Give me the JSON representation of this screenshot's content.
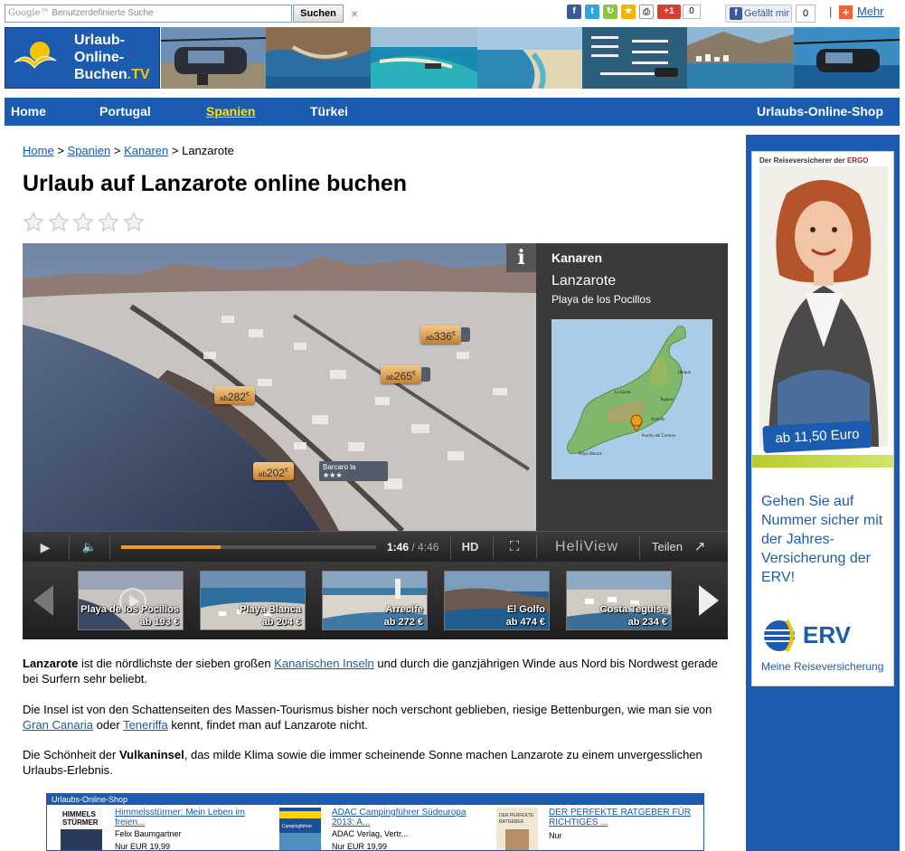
{
  "topbar": {
    "search_placeholder": "Benutzerdefinierte Suche",
    "search_brand": "Google™",
    "search_button": "Suchen",
    "clear": "×",
    "gplus_label": "+1",
    "gplus_count": "0",
    "share_count": "0",
    "fb_like_label": "Gefällt mir",
    "fb_like_count": "0",
    "more_plus": "+",
    "more_label": "Mehr"
  },
  "logo": {
    "line1": "Urlaub-",
    "line2": "Online-",
    "line3": "Buchen",
    "line3_suffix": ".TV"
  },
  "nav": {
    "items": [
      {
        "label": "Home"
      },
      {
        "label": "Portugal"
      },
      {
        "label": "Spanien"
      },
      {
        "label": "Türkei"
      }
    ],
    "shop": "Urlaubs-Online-Shop"
  },
  "breadcrumb": {
    "home": "Home",
    "sep": ">",
    "spanien": "Spanien",
    "kanaren": "Kanaren",
    "current": "Lanzarote"
  },
  "page_title": "Urlaub auf Lanzarote online buchen",
  "rating": {
    "stars": 0,
    "max": 5
  },
  "player": {
    "info_icon": "i",
    "region": "Kanaren",
    "island": "Lanzarote",
    "beach": "Playa de los Pocillos",
    "price_tags": [
      {
        "prefix": "ab",
        "value": "336",
        "unit": "€"
      },
      {
        "prefix": "ab",
        "value": "265",
        "unit": "€"
      },
      {
        "prefix": "ab",
        "value": "282",
        "unit": "€"
      },
      {
        "prefix": "ab",
        "value": "202",
        "unit": "€"
      }
    ],
    "hotel_popup": {
      "name": "Barcaro la",
      "stars": "★★★"
    },
    "controls": {
      "play_icon": "▶",
      "volume_icon": "🔈",
      "progress": 0.39,
      "time_current": "1:46",
      "time_sep": " / ",
      "time_total": "4:46",
      "hd": "HD",
      "fullscreen_icon": "⛶",
      "heliview": "HeliView",
      "share": "Teilen",
      "share_icon": "↗"
    },
    "thumbnails": [
      {
        "name": "Playa de los Pocillos",
        "price": "ab 193 €"
      },
      {
        "name": "Playa Blanca",
        "price": "ab 204 €"
      },
      {
        "name": "Arrecife",
        "price": "ab 272 €"
      },
      {
        "name": "El Golfo",
        "price": "ab 474 €"
      },
      {
        "name": "Costa Teguise",
        "price": "ab 234 €"
      }
    ]
  },
  "content": {
    "p1_bold": "Lanzarote",
    "p1_a": " ist die nördlichste der sieben großen ",
    "p1_link": "Kanarischen Inseln",
    "p1_b": " und durch die ganzjährigen Winde aus Nord bis Nordwest gerade bei Surfern sehr beliebt.",
    "p2_a": "Die Insel ist von den Schattenseiten des Massen-Tourismus bisher noch verschont geblieben, riesige Bettenburgen, wie man sie von ",
    "p2_link1": "Gran Canaria",
    "p2_b": " oder ",
    "p2_link2": "Teneriffa",
    "p2_c": " kennt, findet man auf Lanzarote nicht.",
    "p3_a": "Die Schönheit der ",
    "p3_bold": "Vulkaninsel",
    "p3_b": ", das milde Klima sowie die immer scheinende Sonne machen Lanzarote zu einem unvergesslichen Urlaubs-Erlebnis."
  },
  "shop": {
    "header": "Urlaubs-Online-Shop",
    "books": [
      {
        "title": "Himmelsstürmer: Mein Leben im freien...",
        "author": "Felix Baumgartner",
        "price": "Nur EUR 19,99",
        "cover_text": "HIMMELS STÜRMER"
      },
      {
        "title": "ADAC Campingführer Südeuropa 2013: A...",
        "author": "ADAC Verlag, Vertr...",
        "price": "Nur EUR 19,99",
        "cover_text": "Campingführer"
      },
      {
        "title": "DER PERFEKTE RATGEBER FÜR RICHTIGES ...",
        "author": "",
        "price": "Nur",
        "cover_text": "DER PERFEKTE RATGEBER"
      }
    ]
  },
  "ad": {
    "top_text": "Der Reiseversicherer der ",
    "top_brand": "ERGO",
    "price": "ab 11,50 Euro",
    "headline": "Gehen Sie auf Nummer sicher mit der Jahres-Versicherung der ERV!",
    "brand": "ERV",
    "slogan": "Meine Reiseversicherung"
  },
  "colors": {
    "brand_blue": "#1c5cb0",
    "nav_active": "#ffe100",
    "link": "#1a5aa8",
    "progress": "#f39a1e"
  }
}
